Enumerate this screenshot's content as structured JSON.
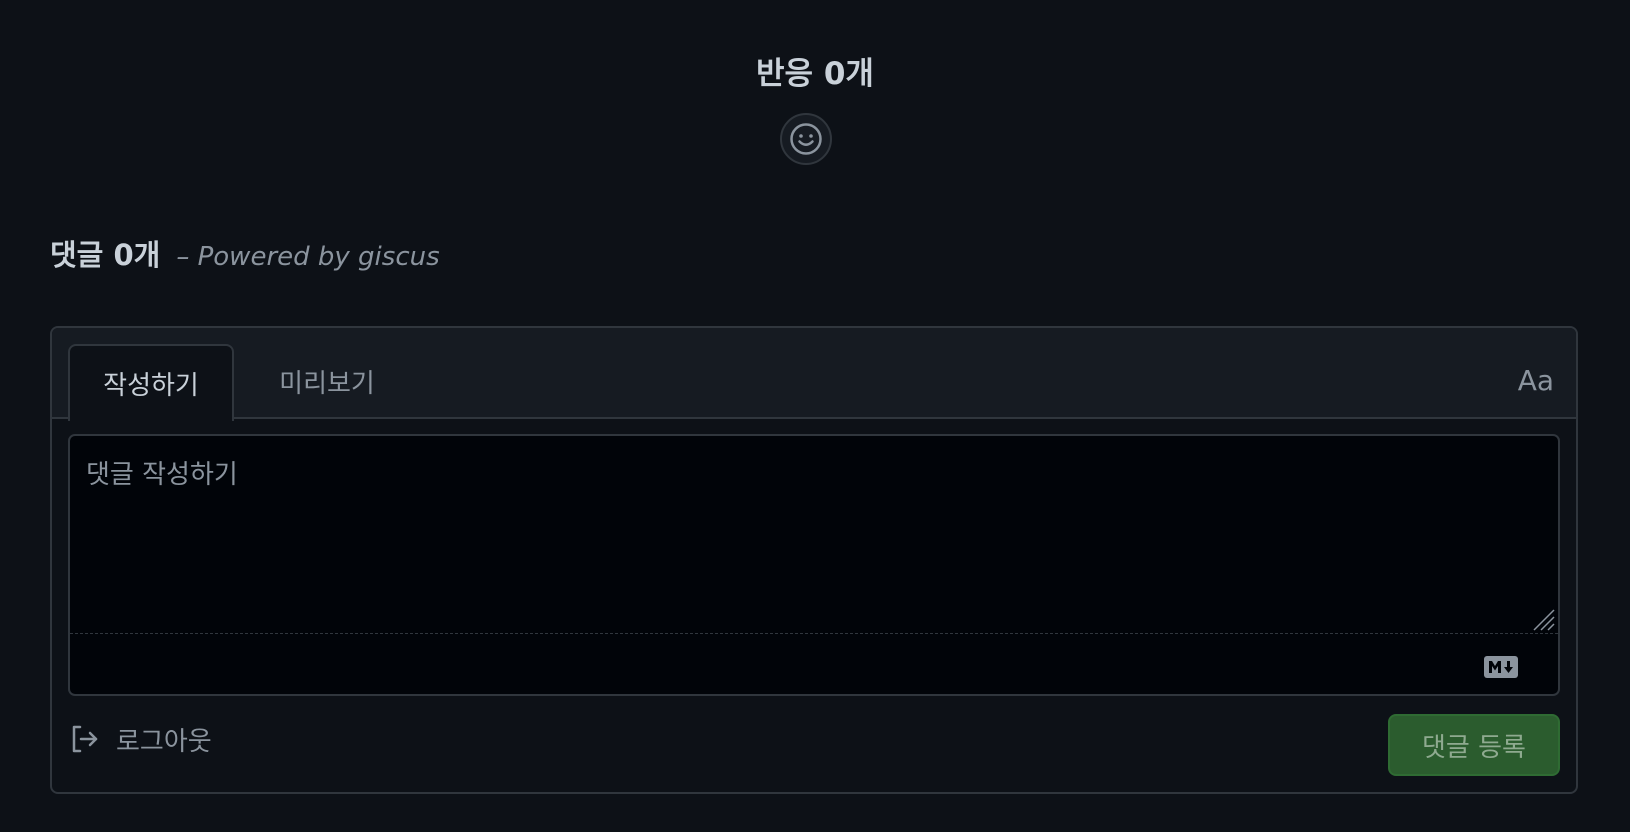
{
  "reactions": {
    "title": "반응 0개",
    "add_reaction_icon": "smiley-icon"
  },
  "comments": {
    "count_label": "댓글 0개",
    "powered_by": "– Powered by giscus"
  },
  "editor": {
    "tabs": [
      {
        "label": "작성하기",
        "active": true
      },
      {
        "label": "미리보기",
        "active": false
      }
    ],
    "font_toggle_label": "Aa",
    "placeholder": "댓글 작성하기",
    "value": "",
    "markdown_icon": "markdown-icon"
  },
  "actions": {
    "logout_label": "로그아웃",
    "logout_icon": "sign-out-icon",
    "submit_label": "댓글 등록"
  },
  "colors": {
    "background": "#0d1117",
    "border": "#30363d",
    "text": "#c9d1d9",
    "muted": "#8b949e",
    "submit_bg": "#2b5c2e"
  }
}
